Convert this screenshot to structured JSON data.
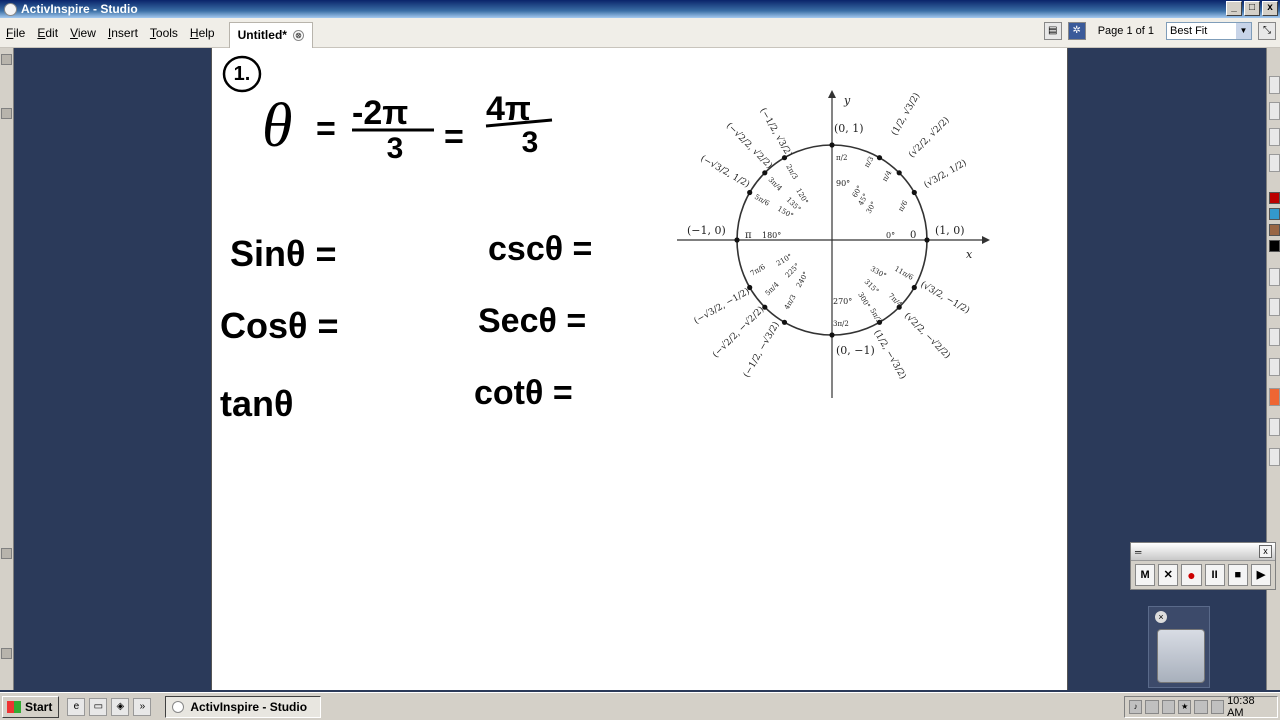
{
  "window": {
    "title": "ActivInspire - Studio",
    "buttons": {
      "minimize": "_",
      "maximize": "□",
      "close": "x"
    }
  },
  "menu": [
    "File",
    "Edit",
    "View",
    "Insert",
    "Tools",
    "Help"
  ],
  "document_tab": {
    "label": "Untitled*",
    "close": "⊗"
  },
  "toolbar": {
    "page_label": "Page 1 of 1",
    "zoom": "Best Fit"
  },
  "whiteboard": {
    "problem_number": "1.",
    "theta_eq": "θ = -2π/3 = 4π/3",
    "theta_symbol": "θ",
    "eq_sign": "=",
    "theta_num1": "-2π",
    "theta_den1": "3",
    "theta_num2": "4π",
    "theta_den2": "3",
    "sin": "Sinθ =",
    "cos": "Cosθ =",
    "tan": "tanθ",
    "csc": "cscθ =",
    "sec": "Secθ =",
    "cot": "cotθ ="
  },
  "unit_circle": {
    "axis_y": "y",
    "axis_x": "x",
    "pt_top": "(0, 1)",
    "pt_left": "(−1, 0)",
    "pt_right": "(1, 0)",
    "pt_bottom": "(0, −1)",
    "angles": {
      "deg0": "0°",
      "rad0": "0",
      "deg30": "30°",
      "deg45": "45°",
      "deg60": "60°",
      "deg90": "90°",
      "rad90": "π/2",
      "deg120": "120°",
      "deg135": "135°",
      "deg150": "150°",
      "deg180": "180°",
      "rad180": "π",
      "deg210": "210°",
      "deg225": "225°",
      "deg240": "240°",
      "deg270": "270°",
      "rad270": "3π/2",
      "deg300": "300°",
      "deg315": "315°",
      "deg330": "330°",
      "rad30": "π/6",
      "rad45": "π/4",
      "rad60": "π/3",
      "rad120": "2π/3",
      "rad135": "3π/4",
      "rad150": "5π/6",
      "rad210": "7π/6",
      "rad225": "5π/4",
      "rad240": "4π/3",
      "rad300": "5π/3",
      "rad315": "7π/4",
      "rad330": "11π/6"
    },
    "coords": {
      "q1_60": "(1/2, √3/2)",
      "q1_45": "(√2/2, √2/2)",
      "q1_30": "(√3/2, 1/2)",
      "q2_120": "(−1/2, √3/2)",
      "q2_135": "(−√2/2, √2/2)",
      "q2_150": "(−√3/2, 1/2)",
      "q3_210": "(−√3/2, −1/2)",
      "q3_225": "(−√2/2, −√2/2)",
      "q3_240": "(−1/2, −√3/2)",
      "q4_300": "(1/2, −√3/2)",
      "q4_315": "(√2/2, −√2/2)",
      "q4_330": "(√3/2, −1/2)"
    }
  },
  "recorder": {
    "m": "M",
    "x": "✕",
    "rec": "●",
    "pause": "II",
    "stop": "■",
    "play": "▶",
    "close": "x"
  },
  "taskbar": {
    "start": "Start",
    "task": "ActivInspire - Studio",
    "clock": "10:38 AM"
  }
}
